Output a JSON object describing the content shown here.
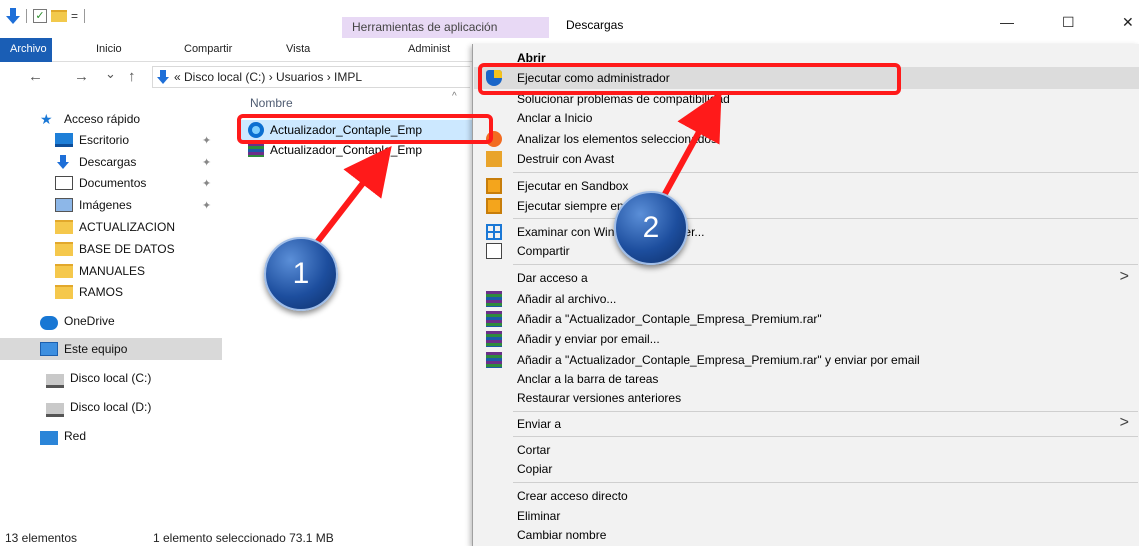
{
  "titlebar": {
    "tools_tab": "Herramientas de aplicación",
    "window_title": "Descargas",
    "minimize": "—",
    "maximize": "☐",
    "close": "✕"
  },
  "ribbon": {
    "file": "Archivo",
    "tabs": [
      "Inicio",
      "Compartir",
      "Vista",
      "Administ"
    ]
  },
  "address": {
    "back": "←",
    "forward": "→",
    "recent": "⌄",
    "up": "↑",
    "path": "« Disco local (C:)  ›  Usuarios  ›  IMPL"
  },
  "nav_pane": {
    "items": [
      {
        "label": "Acceso rápido",
        "icon": "star-icon"
      },
      {
        "label": "Escritorio",
        "icon": "desktop-icon",
        "pinned": true
      },
      {
        "label": "Descargas",
        "icon": "downloads-icon",
        "pinned": true
      },
      {
        "label": "Documentos",
        "icon": "documents-icon",
        "pinned": true
      },
      {
        "label": "Imágenes",
        "icon": "pictures-icon",
        "pinned": true
      },
      {
        "label": "ACTUALIZACION",
        "icon": "folder-icon"
      },
      {
        "label": "BASE DE DATOS",
        "icon": "folder-icon"
      },
      {
        "label": "MANUALES",
        "icon": "folder-icon"
      },
      {
        "label": "RAMOS",
        "icon": "folder-icon"
      },
      {
        "label": "OneDrive",
        "icon": "onedrive-icon"
      },
      {
        "label": "Este equipo",
        "icon": "this-pc-icon",
        "selected": true
      },
      {
        "label": "Disco local (C:)",
        "icon": "drive-c-icon"
      },
      {
        "label": "Disco local (D:)",
        "icon": "drive-d-icon"
      },
      {
        "label": "Red",
        "icon": "network-icon"
      }
    ],
    "pin_glyph": "✦"
  },
  "file_list": {
    "column_name": "Nombre",
    "sort_caret": "^",
    "files": [
      {
        "name": "Actualizador_Contaple_Emp",
        "icon": "installer-icon",
        "selected": true
      },
      {
        "name": "Actualizador_Contaple_Emp",
        "icon": "winrar-archive-icon"
      }
    ]
  },
  "status_bar": {
    "count": "13 elementos",
    "selection": "1 elemento seleccionado  73.1 MB"
  },
  "context_menu": {
    "items": [
      {
        "label": "Abrir",
        "bold": true
      },
      {
        "label": "Ejecutar como administrador",
        "icon": "uac-shield-icon",
        "highlighted": true
      },
      {
        "label": "Solucionar problemas de compatibilidad"
      },
      {
        "label": "Anclar a Inicio"
      },
      {
        "label": "Analizar los elementos seleccionados",
        "icon": "avast-icon"
      },
      {
        "label": "Destruir con Avast",
        "icon": "shredder-icon"
      },
      {
        "label": "Ejecutar en Sandbox",
        "icon": "sandbox-icon"
      },
      {
        "label": "Ejecutar siempre en Sandbox",
        "icon": "sandbox-icon"
      },
      {
        "label": "Examinar con Windows Defender...",
        "icon": "defender-icon"
      },
      {
        "label": "Compartir",
        "icon": "share-icon"
      },
      {
        "label": "Dar acceso a",
        "submenu": true
      },
      {
        "label": "Añadir al archivo...",
        "icon": "winrar-icon"
      },
      {
        "label": "Añadir a \"Actualizador_Contaple_Empresa_Premium.rar\"",
        "icon": "winrar-icon"
      },
      {
        "label": "Añadir y enviar por email...",
        "icon": "winrar-icon"
      },
      {
        "label": "Añadir a \"Actualizador_Contaple_Empresa_Premium.rar\" y enviar por email",
        "icon": "winrar-icon"
      },
      {
        "label": "Anclar a la barra de tareas"
      },
      {
        "label": "Restaurar versiones anteriores"
      },
      {
        "label": "Enviar a",
        "submenu": true
      },
      {
        "label": "Cortar"
      },
      {
        "label": "Copiar"
      },
      {
        "label": "Crear acceso directo"
      },
      {
        "label": "Eliminar"
      },
      {
        "label": "Cambiar nombre"
      }
    ],
    "submenu_glyph": ">"
  },
  "annotations": {
    "step1": "1",
    "step2": "2",
    "color": "#ff1a1a"
  }
}
